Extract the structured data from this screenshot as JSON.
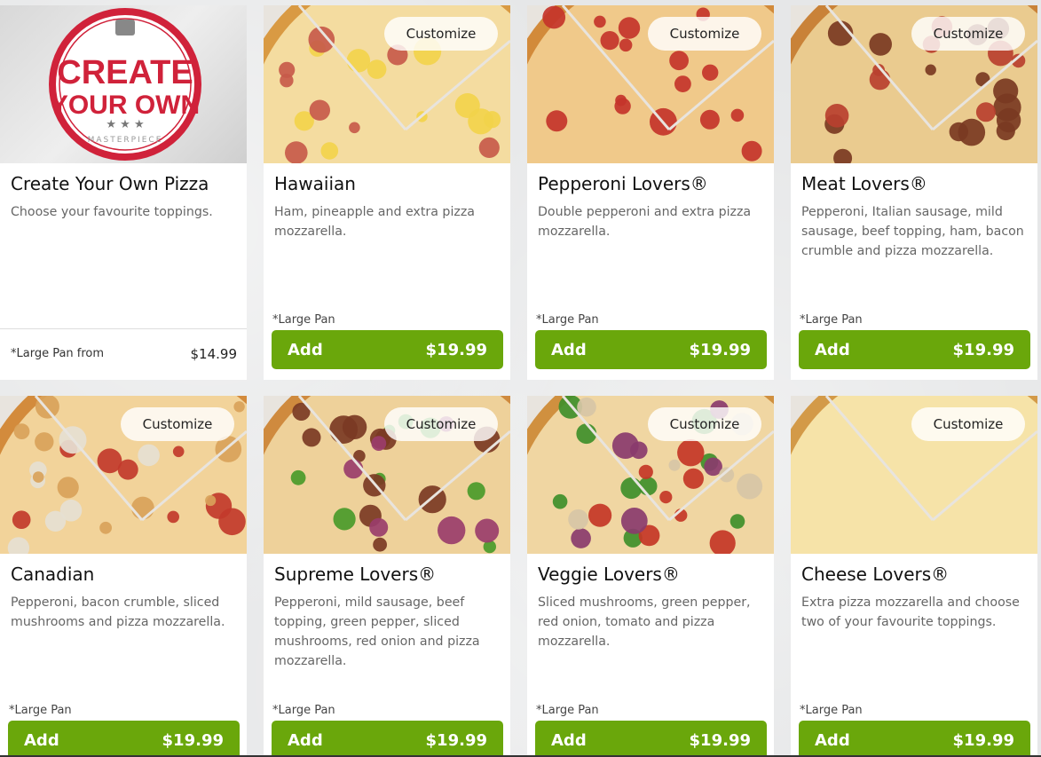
{
  "customize_label": "Customize",
  "add_label": "Add",
  "create_your_own": {
    "badge_line1": "CREATE",
    "badge_line2": "YOUR OWN",
    "badge_line3": "MASTERPIECE",
    "title": "Create Your Own Pizza",
    "description": "Choose your favourite toppings.",
    "size_note": "*Large Pan from",
    "price": "$14.99"
  },
  "pizzas": [
    {
      "title": "Hawaiian",
      "description": "Ham, pineapple and extra pizza mozzarella.",
      "size_note": "*Large Pan",
      "price": "$19.99"
    },
    {
      "title": "Pepperoni Lovers®",
      "description": "Double pepperoni and extra pizza mozzarella.",
      "size_note": "*Large Pan",
      "price": "$19.99"
    },
    {
      "title": "Meat Lovers®",
      "description": "Pepperoni, Italian sausage, mild sausage, beef topping, ham, bacon crumble and pizza mozzarella.",
      "size_note": "*Large Pan",
      "price": "$19.99"
    },
    {
      "title": "Canadian",
      "description": "Pepperoni, bacon crumble, sliced mushrooms and pizza mozzarella.",
      "size_note": "*Large Pan",
      "price": "$19.99"
    },
    {
      "title": "Supreme Lovers®",
      "description": "Pepperoni, mild sausage, beef topping, green pepper, sliced mushrooms, red onion and pizza mozzarella.",
      "size_note": "*Large Pan",
      "price": "$19.99"
    },
    {
      "title": "Veggie Lovers®",
      "description": "Sliced mushrooms, green pepper, red onion, tomato and pizza mozzarella.",
      "size_note": "*Large Pan",
      "price": "$19.99"
    },
    {
      "title": "Cheese Lovers®",
      "description": "Extra pizza mozzarella and choose two of your favourite toppings.",
      "size_note": "*Large Pan",
      "price": "$19.99"
    }
  ],
  "colors": {
    "add_button": "#6aa70b",
    "badge_red": "#d0223a"
  }
}
